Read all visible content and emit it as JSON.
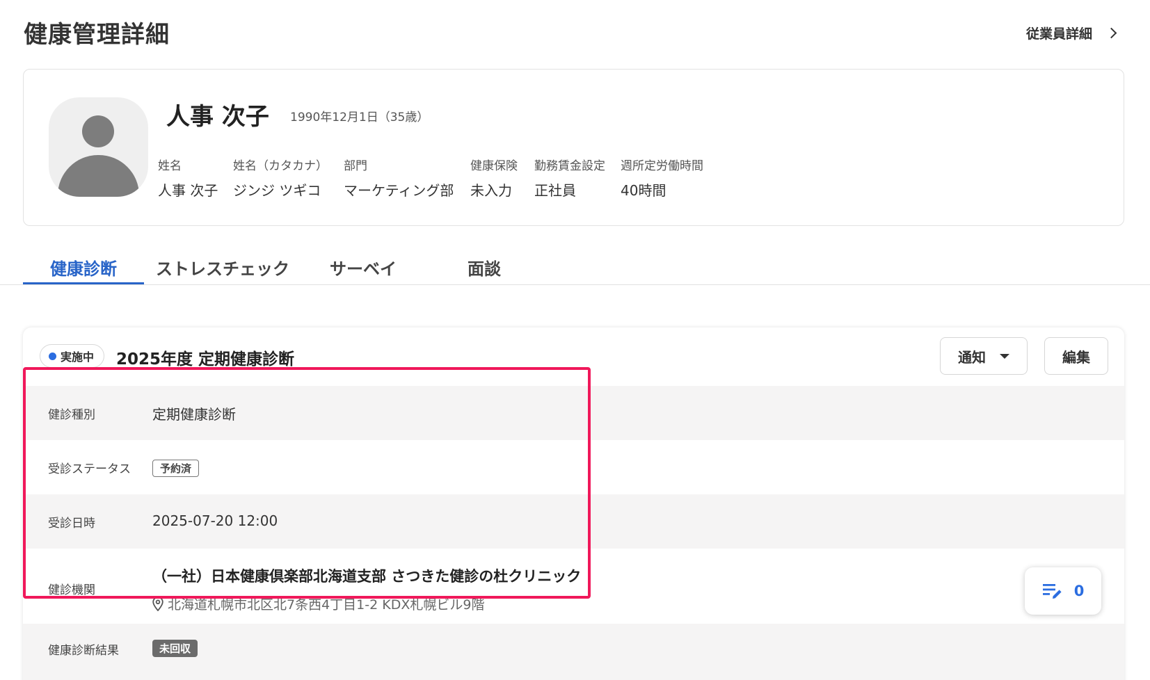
{
  "header": {
    "title": "健康管理詳細",
    "employee_link": "従業員詳細"
  },
  "profile": {
    "name": "人事 次子",
    "birth": "1990年12月1日（35歳）",
    "fields": [
      {
        "label": "姓名",
        "value": "人事 次子"
      },
      {
        "label": "姓名（カタカナ）",
        "value": "ジンジ ツギコ"
      },
      {
        "label": "部門",
        "value": "マーケティング部"
      },
      {
        "label": "健康保険",
        "value": "未入力"
      },
      {
        "label": "勤務賃金設定",
        "value": "正社員"
      },
      {
        "label": "週所定労働時間",
        "value": "40時間"
      }
    ]
  },
  "tabs": [
    {
      "label": "健康診断",
      "active": true
    },
    {
      "label": "ストレスチェック",
      "active": false
    },
    {
      "label": "サーベイ",
      "active": false
    },
    {
      "label": "面談",
      "active": false
    }
  ],
  "exam": {
    "status": "実施中",
    "title": "2025年度 定期健康診断",
    "notify_button": "通知",
    "edit_button": "編集",
    "rows": {
      "type": {
        "label": "健診種別",
        "value": "定期健康診断"
      },
      "status": {
        "label": "受診ステータス",
        "value": "予約済"
      },
      "datetime": {
        "label": "受診日時",
        "value": "2025-07-20 12:00"
      },
      "clinic": {
        "label": "健診機関",
        "name": "（一社）日本健康倶楽部北海道支部 さつきた健診の杜クリニック",
        "address": "北海道札幌市北区北7条西4丁目1-2 KDX札幌ビル9階"
      },
      "result": {
        "label": "健康診断結果",
        "value": "未回収"
      }
    }
  },
  "memo": {
    "count": "0"
  },
  "colors": {
    "accent": "#2864c8",
    "highlight": "#f0185a",
    "status_dot": "#2b6de0"
  }
}
